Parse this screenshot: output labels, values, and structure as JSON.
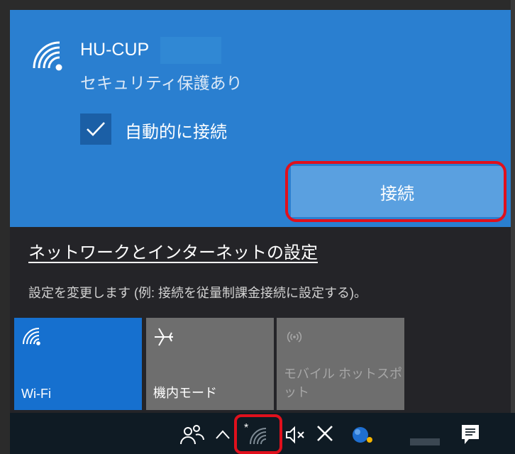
{
  "network": {
    "ssid": "HU-CUP",
    "security": "セキュリティ保護あり",
    "auto_connect_label": "自動的に接続",
    "auto_connect_checked": true,
    "connect_label": "接続",
    "icon": "wifi-secured-icon"
  },
  "settings": {
    "link_label": "ネットワークとインターネットの設定",
    "description": "設定を変更します (例: 接続を従量制課金接続に設定する)。"
  },
  "quick_actions": [
    {
      "label": "Wi-Fi",
      "icon": "wifi-icon",
      "state": "on"
    },
    {
      "label": "機内モード",
      "icon": "airplane-icon",
      "state": "off"
    },
    {
      "label": "モバイル ホットスポット",
      "icon": "hotspot-icon",
      "state": "disabled"
    }
  ],
  "taskbar": {
    "icons": [
      "people-icon",
      "chevron-up-icon",
      "wifi-tray-icon",
      "volume-muted-icon",
      "close-icon",
      "app-icon",
      "notification-icon"
    ]
  },
  "colors": {
    "accent": "#2a7fd0",
    "button": "#5aa0e0",
    "highlight": "#e0101c",
    "panel": "#242428",
    "taskbar": "#0f1b24"
  }
}
